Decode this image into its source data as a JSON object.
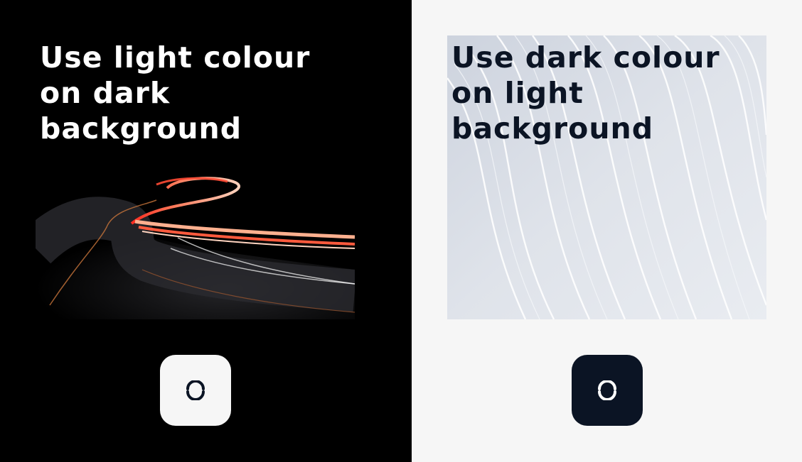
{
  "colors": {
    "dark_background": "#000000",
    "light_background": "#f6f6f6",
    "dark_text": "#0b1424",
    "light_text": "#ffffff",
    "light_trail_red": "#ff3b2f"
  },
  "panels": [
    {
      "headline": "Use light colour\non dark\nbackground",
      "photo": "night-road-light-trails",
      "button_icon": "sync-icon"
    },
    {
      "headline": "Use dark colour\non light\nbackground",
      "photo": "white-wave-lines",
      "button_icon": "sync-icon"
    }
  ]
}
